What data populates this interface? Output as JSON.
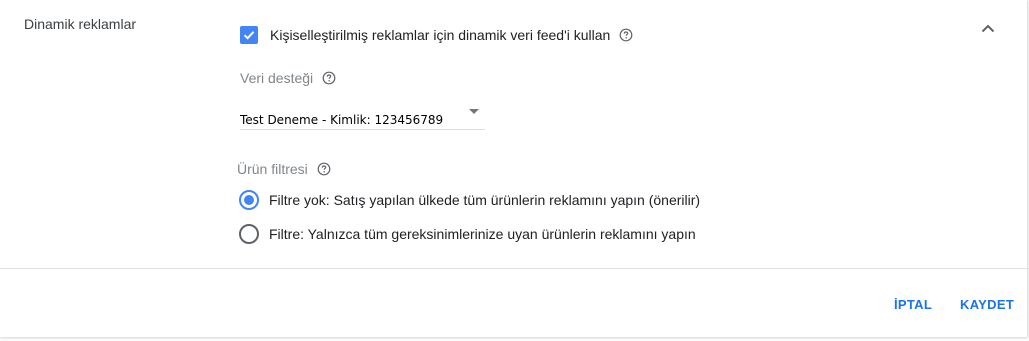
{
  "section": {
    "title": "Dinamik reklamlar"
  },
  "dynamic_feed": {
    "checked": true,
    "label": "Kişiselleştirilmiş reklamlar için dinamik veri feed'i kullan"
  },
  "data_source": {
    "label": "Veri desteği",
    "selected_value": "Test Deneme - Kimlik: 123456789"
  },
  "product_filter": {
    "label": "Ürün filtresi",
    "options": [
      {
        "label": "Filtre yok: Satış yapılan ülkede tüm ürünlerin reklamını yapın (önerilir)",
        "selected": true
      },
      {
        "label": "Filtre: Yalnızca tüm gereksinimlerinize uyan ürünlerin reklamını yapın",
        "selected": false
      }
    ]
  },
  "actions": {
    "cancel_label": "İPTAL",
    "save_label": "KAYDET"
  },
  "colors": {
    "accent": "#4285f4",
    "button_text": "#1a73e8",
    "muted_text": "#80868b"
  },
  "icons": {
    "collapse": "chevron-up-icon",
    "help": "help-circle-icon",
    "checkbox": "checkmark-icon"
  }
}
